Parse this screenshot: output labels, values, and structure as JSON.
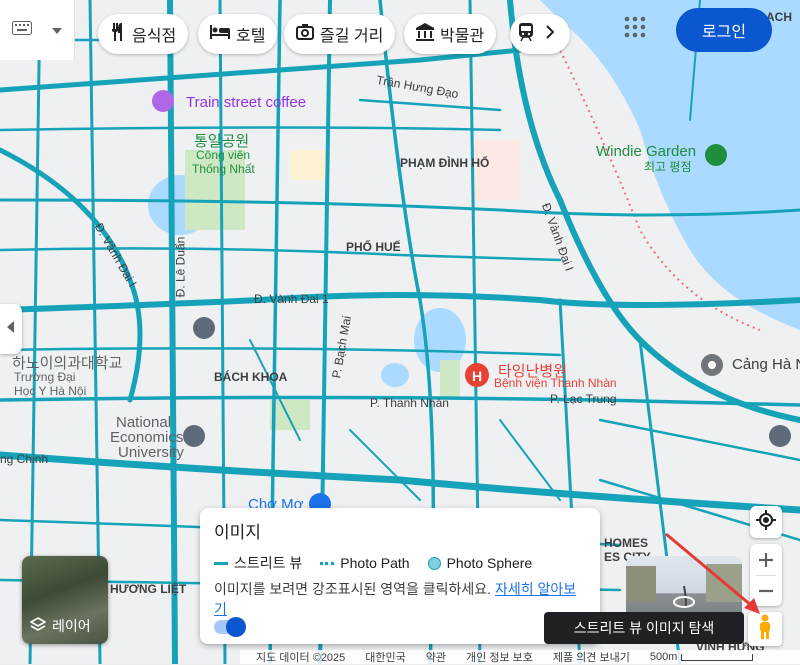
{
  "toolbar": {
    "chips": [
      {
        "label": "음식점",
        "icon": "fork-knife-icon"
      },
      {
        "label": "호텔",
        "icon": "bed-icon"
      },
      {
        "label": "즐길 거리",
        "icon": "camera-icon"
      },
      {
        "label": "박물관",
        "icon": "museum-icon"
      },
      {
        "label": "",
        "icon": "train-icon"
      }
    ],
    "login_label": "로그인"
  },
  "map_labels": {
    "train_street_coffee": "Train street coffee",
    "tran_hung_dao": "Trần Hưng Đạo",
    "thong_nhat_ko": "통일공원",
    "thong_nhat_vn1": "Công viên",
    "thong_nhat_vn2": "Thống Nhất",
    "pham_dinh_ho": "PHẠM ĐÌNH HỔ",
    "pho_hue": "PHỐ HUẾ",
    "windie_en": "Windie Garden",
    "windie_ko": "최고 평점",
    "d_van_dai": "Đ. Vành Đai I",
    "d_le_duan": "Đ. Lê Duẩn",
    "d_vanh_dai_1": "Đ. Vành Đai 1",
    "d_vanh_dai_i_right": "Đ. Vành Đai I",
    "bach_khoa": "BÁCH KHOA",
    "p_bach_mai": "P. Bạch Mai",
    "hospital_ko": "타잉난병원",
    "hospital_vn": "Bệnh viện Thanh Nhàn",
    "p_thanh_nhan": "P. Thanh Nhàn",
    "p_lac_trung": "P. Lạc Trung",
    "cang_ha_noi": "Cảng Hà N",
    "hanoi_med_ko": "하노이의과대학교",
    "hanoi_med_vn1": "Trường Đại",
    "hanoi_med_vn2": "Học Y Hà Nội",
    "neu1": "National",
    "neu2": "Economics",
    "neu3": "University",
    "truong_chinh": "ng Chinh",
    "cho_mo": "Chợ Mơ",
    "homes_city": "HOMES",
    "homes_city2": "ES CITY",
    "phuong_liet": "HƯƠNG LIỆT",
    "vinh_hung": "VĨNH HƯNG",
    "top_right": "ACH"
  },
  "layers": {
    "label": "레이어"
  },
  "imagery_panel": {
    "title": "이미지",
    "legend_street_view": "스트리트 뷰",
    "legend_photo_path": "Photo Path",
    "legend_photo_sphere": "Photo Sphere",
    "description": "이미지를 보려면 강조표시된 영역을 클릭하세요.",
    "learn_more": "자세히 알아보기",
    "toggle_on": true
  },
  "tooltip": "스트리트 뷰 이미지 탐색",
  "footer": {
    "map_data": "지도 데이터 ©2025",
    "country": "대한민국",
    "terms": "약관",
    "privacy": "개인 정보 보호",
    "feedback": "제품 의견 보내기",
    "scale": "500m"
  },
  "colors": {
    "road": "#16a2b8",
    "water": "#aadaff",
    "park": "#cfe8c4",
    "login": "#0b57d0",
    "hospital": "#e94235"
  }
}
